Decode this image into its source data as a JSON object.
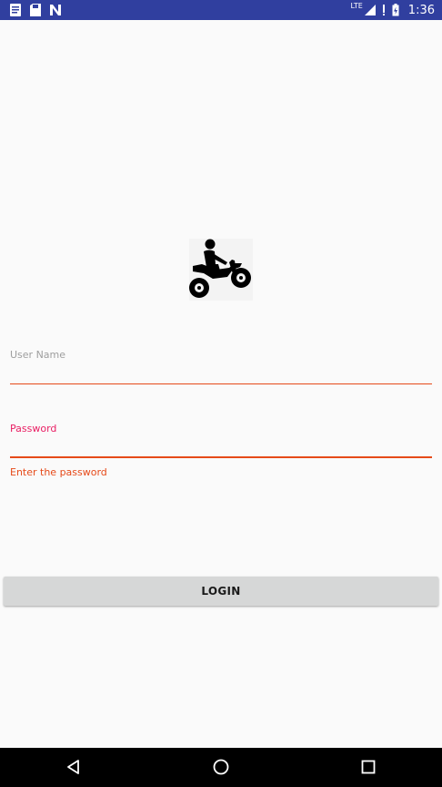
{
  "status_bar": {
    "background": "#303f9f",
    "left_icons": [
      "document-notification-icon",
      "save-notification-icon",
      "n-app-notification-icon"
    ],
    "network_label": "LTE",
    "time": "1:36"
  },
  "logo": {
    "icon": "motorcycle-rider-icon"
  },
  "form": {
    "username": {
      "label": "User Name",
      "value": ""
    },
    "password": {
      "label": "Password",
      "value": "",
      "error": "Enter the password"
    },
    "accent_color": "#e91e63",
    "error_color": "#e64a19"
  },
  "login_button": {
    "label": "LOGIN"
  },
  "nav_bar": {
    "buttons": [
      "back-icon",
      "home-icon",
      "recents-icon"
    ]
  }
}
